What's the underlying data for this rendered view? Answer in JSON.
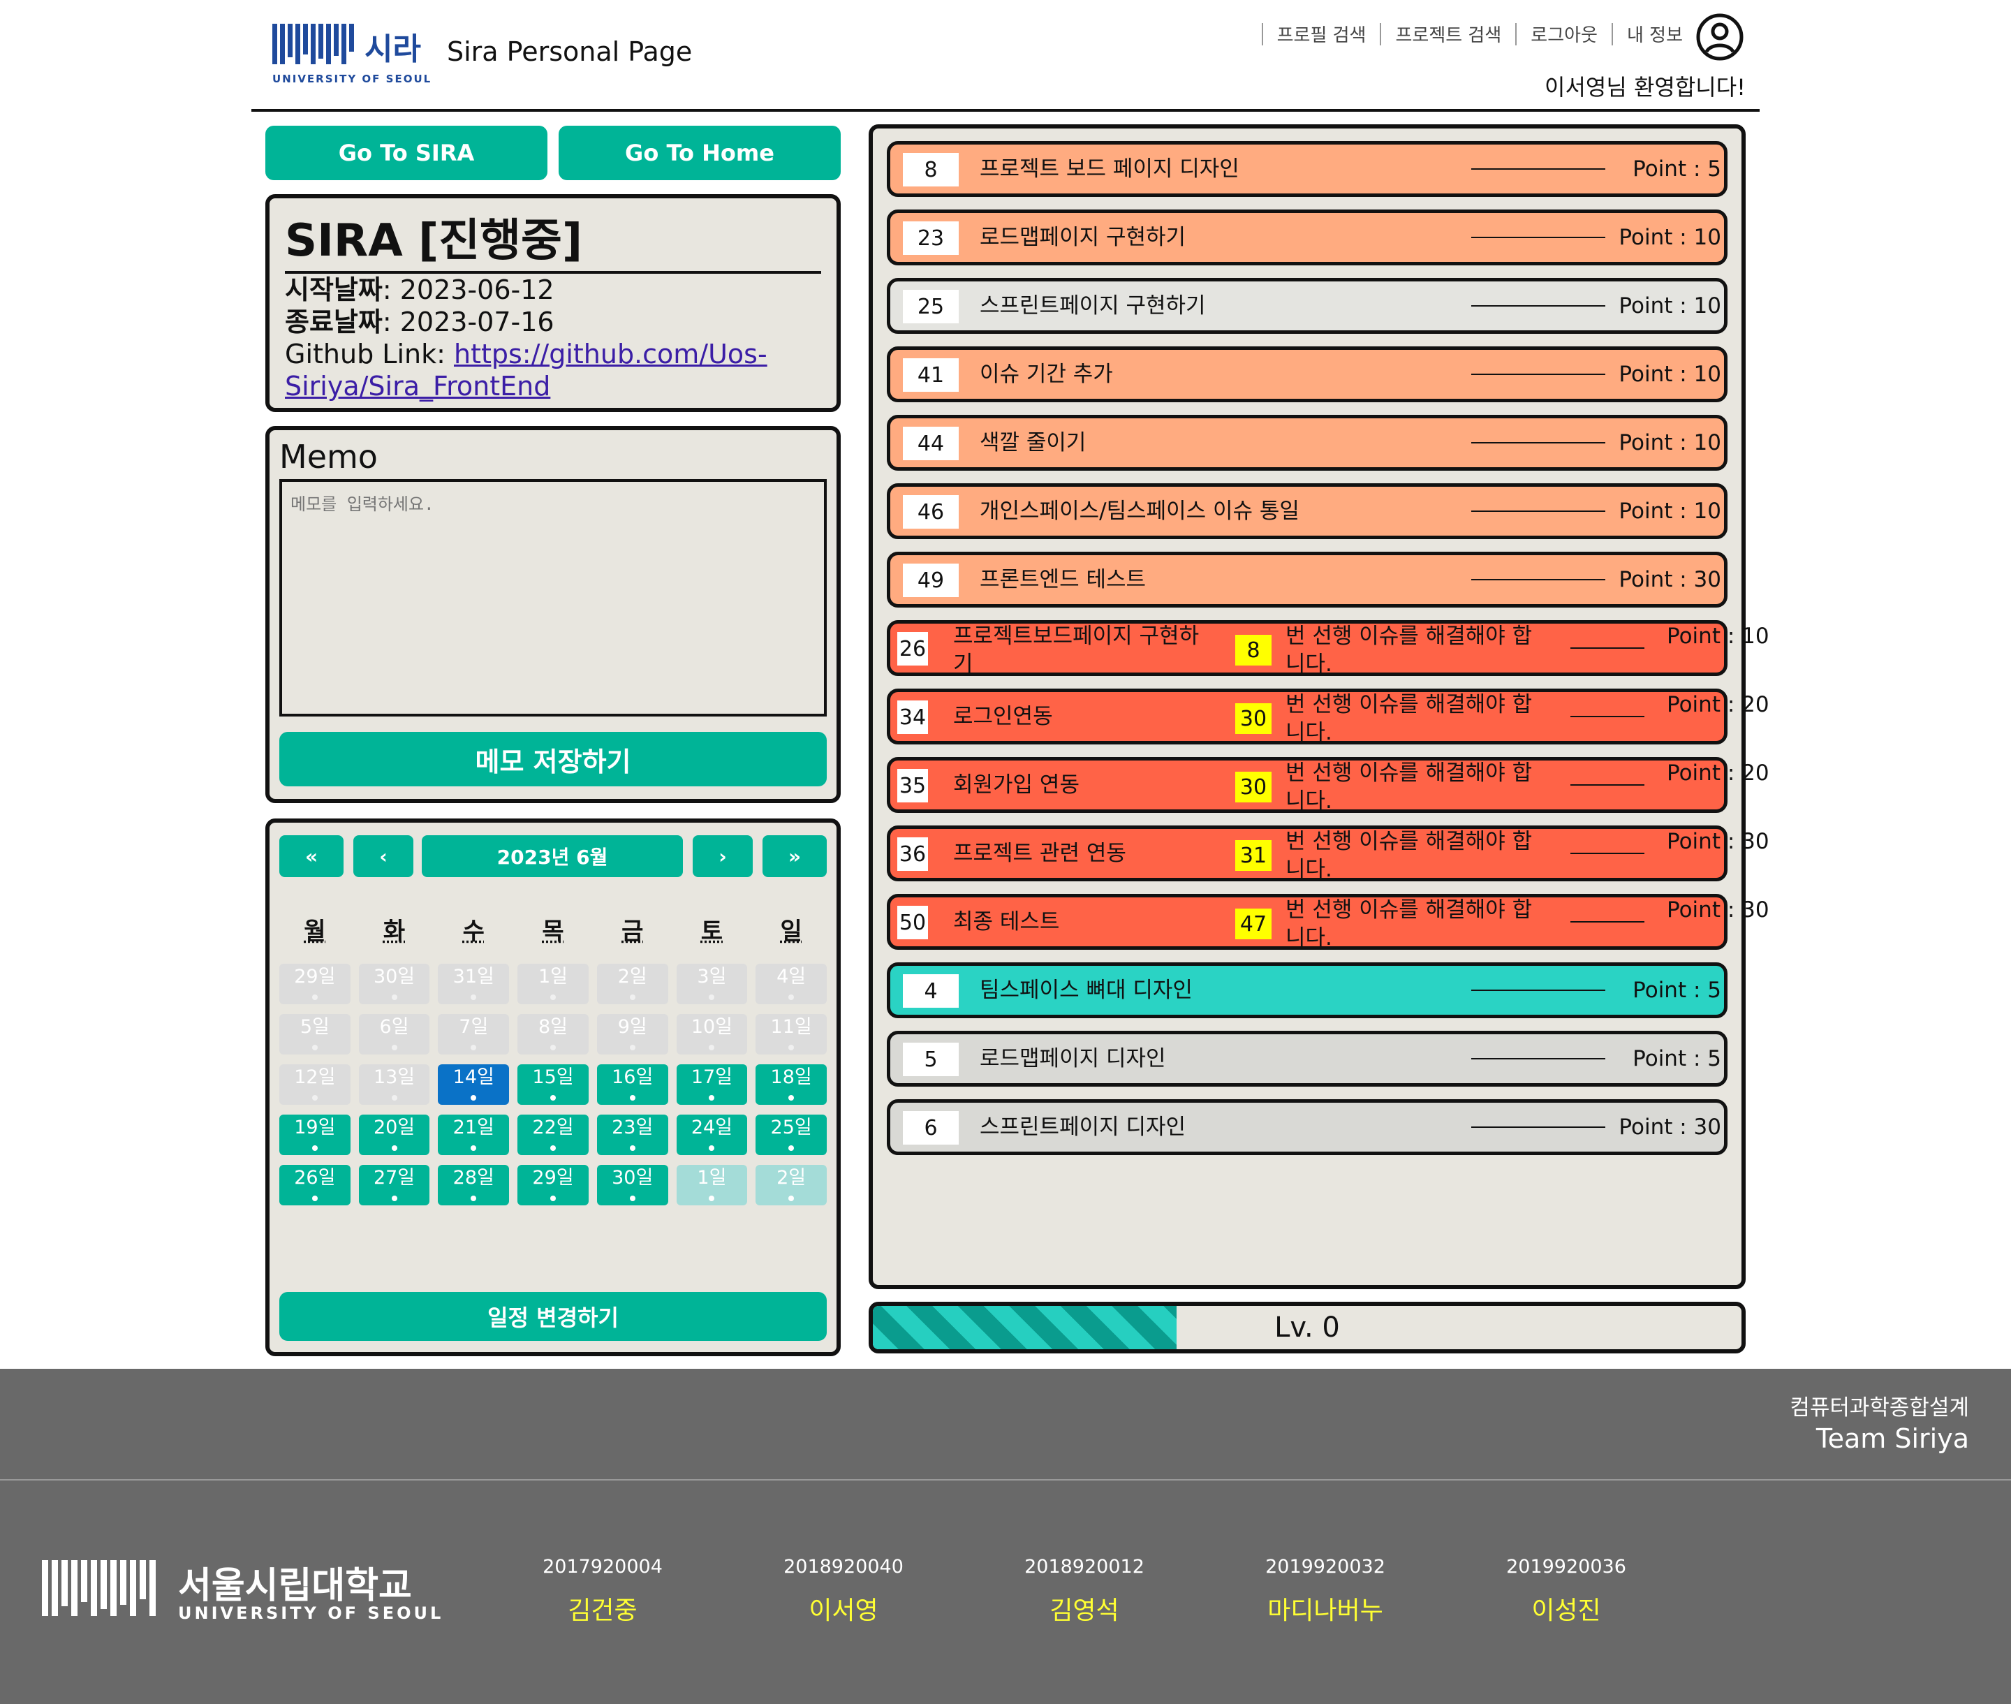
{
  "header": {
    "logo_text": "시라",
    "logo_sub": "UNIVERSITY OF SEOUL",
    "site_title": "Sira Personal Page",
    "nav": [
      "프로필 검색",
      "프로젝트 검색",
      "로그아웃",
      "내 정보"
    ],
    "avatar_icon": "user-circle-icon",
    "welcome": "이서영님 환영합니다!"
  },
  "left": {
    "go_sira": "Go To SIRA",
    "go_home": "Go To Home",
    "project": {
      "title": "SIRA [진행중]",
      "start_label": "시작날짜",
      "start_value": ": 2023-06-12",
      "end_label": "종료날짜",
      "end_value": ": 2023-07-16",
      "github_label": "Github Link: ",
      "github_url": "https://github.com/Uos-Siriya/Sira_FrontEnd"
    },
    "memo": {
      "title": "Memo",
      "placeholder": "메모를 입력하세요.",
      "save_label": "메모 저장하기"
    },
    "calendar": {
      "first_label": "«",
      "prev_label": "‹",
      "month_label": "2023년 6월",
      "next_label": "›",
      "last_label": "»",
      "weekdays": [
        "월",
        "화",
        "수",
        "목",
        "금",
        "토",
        "일"
      ],
      "days": [
        {
          "label": "29일",
          "state": "past"
        },
        {
          "label": "30일",
          "state": "past"
        },
        {
          "label": "31일",
          "state": "past"
        },
        {
          "label": "1일",
          "state": "past"
        },
        {
          "label": "2일",
          "state": "past"
        },
        {
          "label": "3일",
          "state": "past"
        },
        {
          "label": "4일",
          "state": "past"
        },
        {
          "label": "5일",
          "state": "past"
        },
        {
          "label": "6일",
          "state": "past"
        },
        {
          "label": "7일",
          "state": "past"
        },
        {
          "label": "8일",
          "state": "past"
        },
        {
          "label": "9일",
          "state": "past"
        },
        {
          "label": "10일",
          "state": "past"
        },
        {
          "label": "11일",
          "state": "past"
        },
        {
          "label": "12일",
          "state": "past"
        },
        {
          "label": "13일",
          "state": "past"
        },
        {
          "label": "14일",
          "state": "today"
        },
        {
          "label": "15일",
          "state": "future"
        },
        {
          "label": "16일",
          "state": "future"
        },
        {
          "label": "17일",
          "state": "future"
        },
        {
          "label": "18일",
          "state": "future"
        },
        {
          "label": "19일",
          "state": "future"
        },
        {
          "label": "20일",
          "state": "future"
        },
        {
          "label": "21일",
          "state": "future"
        },
        {
          "label": "22일",
          "state": "future"
        },
        {
          "label": "23일",
          "state": "future"
        },
        {
          "label": "24일",
          "state": "future"
        },
        {
          "label": "25일",
          "state": "future"
        },
        {
          "label": "26일",
          "state": "future"
        },
        {
          "label": "27일",
          "state": "future"
        },
        {
          "label": "28일",
          "state": "future"
        },
        {
          "label": "29일",
          "state": "future"
        },
        {
          "label": "30일",
          "state": "future"
        },
        {
          "label": "1일",
          "state": "next"
        },
        {
          "label": "2일",
          "state": "next"
        }
      ],
      "change_label": "일정 변경하기"
    }
  },
  "issues": [
    {
      "num": "8",
      "title": "프로젝트 보드 페이지 디자인",
      "point": "Point : 5",
      "style": "orange"
    },
    {
      "num": "23",
      "title": "로드맵페이지 구현하기",
      "point": "Point : 10",
      "style": "orange"
    },
    {
      "num": "25",
      "title": "스프린트페이지 구현하기",
      "point": "Point : 10",
      "style": "gray"
    },
    {
      "num": "41",
      "title": "이슈 기간 추가",
      "point": "Point : 10",
      "style": "orange"
    },
    {
      "num": "44",
      "title": "색깔 줄이기",
      "point": "Point : 10",
      "style": "orange"
    },
    {
      "num": "46",
      "title": "개인스페이스/팀스페이스 이슈 통일",
      "point": "Point : 10",
      "style": "orange"
    },
    {
      "num": "49",
      "title": "프론트엔드 테스트",
      "point": "Point : 30",
      "style": "orange"
    },
    {
      "num": "26",
      "title": "프로젝트보드페이지 구현하기",
      "point": "Point : 10",
      "style": "red",
      "blocker": "8",
      "blocker_text": "번 선행 이슈를 해결해야 합니다."
    },
    {
      "num": "34",
      "title": "로그인연동",
      "point": "Point : 20",
      "style": "red",
      "blocker": "30",
      "blocker_text": "번 선행 이슈를 해결해야 합니다."
    },
    {
      "num": "35",
      "title": "회원가입 연동",
      "point": "Point : 20",
      "style": "red",
      "blocker": "30",
      "blocker_text": "번 선행 이슈를 해결해야 합니다."
    },
    {
      "num": "36",
      "title": "프로젝트 관련 연동",
      "point": "Point : 30",
      "style": "red",
      "blocker": "31",
      "blocker_text": "번 선행 이슈를 해결해야 합니다."
    },
    {
      "num": "50",
      "title": "최종 테스트",
      "point": "Point : 30",
      "style": "red",
      "blocker": "47",
      "blocker_text": "번 선행 이슈를 해결해야 합니다."
    },
    {
      "num": "4",
      "title": "팀스페이스 뼈대 디자인",
      "point": "Point : 5",
      "style": "cyan"
    },
    {
      "num": "5",
      "title": "로드맵페이지 디자인",
      "point": "Point : 5",
      "style": "gray2"
    },
    {
      "num": "6",
      "title": "스프린트페이지 디자인",
      "point": "Point : 30",
      "style": "gray2"
    }
  ],
  "level": {
    "label": "Lv. 0",
    "progress": 0.35
  },
  "footer": {
    "course": "컴퓨터과학종합설계",
    "team": "Team Siriya",
    "uni_name": "서울시립대학교",
    "uni_sub": "UNIVERSITY OF SEOUL",
    "members": [
      {
        "id": "2017920004",
        "name": "김건중"
      },
      {
        "id": "2018920040",
        "name": "이서영"
      },
      {
        "id": "2018920012",
        "name": "김영석"
      },
      {
        "id": "2019920032",
        "name": "마디나버누"
      },
      {
        "id": "2019920036",
        "name": "이성진"
      }
    ]
  },
  "colors": {
    "accent": "#00b497",
    "issue_orange": "#ffab80",
    "issue_red": "#ff6347",
    "issue_cyan": "#2ad3c4",
    "today": "#0a72c7",
    "footer": "#696969",
    "member_name": "#ffff33"
  }
}
